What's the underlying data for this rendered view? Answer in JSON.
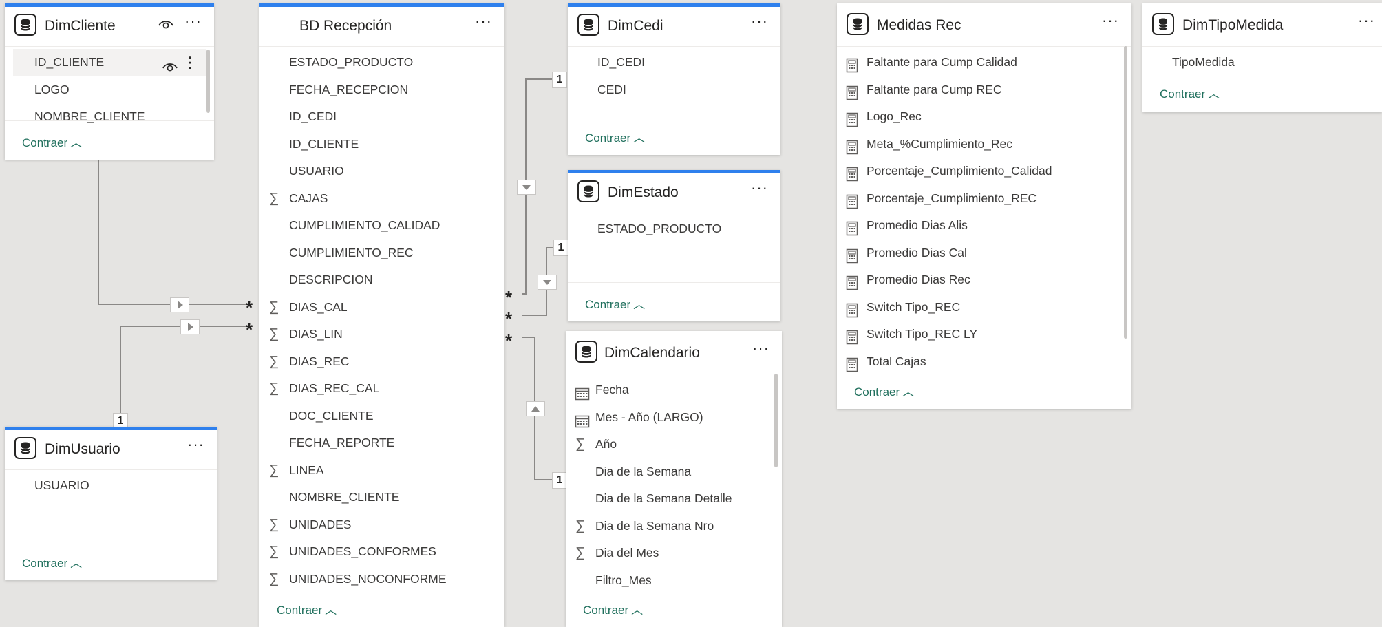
{
  "colors": {
    "canvas": "#e5e4e2",
    "selected_border": "#2f80ed",
    "collapse_link": "#1f6f5c",
    "wire": "#8a8886"
  },
  "collapse_label": "Contraer",
  "tables": {
    "dimcliente": {
      "title": "DimCliente",
      "fields": [
        "ID_CLIENTE",
        "LOGO",
        "NOMBRE_CLIENTE"
      ]
    },
    "bdrecepcion": {
      "title": "BD Recepción",
      "fields": [
        {
          "name": "ESTADO_PRODUCTO",
          "type": "text"
        },
        {
          "name": "FECHA_RECEPCION",
          "type": "text"
        },
        {
          "name": "ID_CEDI",
          "type": "text"
        },
        {
          "name": "ID_CLIENTE",
          "type": "text"
        },
        {
          "name": "USUARIO",
          "type": "text"
        },
        {
          "name": "CAJAS",
          "type": "sum"
        },
        {
          "name": "CUMPLIMIENTO_CALIDAD",
          "type": "text"
        },
        {
          "name": "CUMPLIMIENTO_REC",
          "type": "text"
        },
        {
          "name": "DESCRIPCION",
          "type": "text"
        },
        {
          "name": "DIAS_CAL",
          "type": "sum"
        },
        {
          "name": "DIAS_LIN",
          "type": "sum"
        },
        {
          "name": "DIAS_REC",
          "type": "sum"
        },
        {
          "name": "DIAS_REC_CAL",
          "type": "sum"
        },
        {
          "name": "DOC_CLIENTE",
          "type": "text"
        },
        {
          "name": "FECHA_REPORTE",
          "type": "text"
        },
        {
          "name": "LINEA",
          "type": "sum"
        },
        {
          "name": "NOMBRE_CLIENTE",
          "type": "text"
        },
        {
          "name": "UNIDADES",
          "type": "sum"
        },
        {
          "name": "UNIDADES_CONFORMES",
          "type": "sum"
        },
        {
          "name": "UNIDADES_NOCONFORME",
          "type": "sum"
        }
      ]
    },
    "dimcedi": {
      "title": "DimCedi",
      "fields": [
        "ID_CEDI",
        "CEDI"
      ]
    },
    "dimestado": {
      "title": "DimEstado",
      "fields": [
        "ESTADO_PRODUCTO"
      ]
    },
    "dimcalendario": {
      "title": "DimCalendario",
      "fields": [
        {
          "name": "Fecha",
          "type": "calendar"
        },
        {
          "name": "Mes - Año (LARGO)",
          "type": "calendar"
        },
        {
          "name": "Año",
          "type": "sum"
        },
        {
          "name": "Dia de la Semana",
          "type": "text"
        },
        {
          "name": "Dia de la Semana Detalle",
          "type": "text"
        },
        {
          "name": "Dia de la Semana Nro",
          "type": "sum"
        },
        {
          "name": "Dia del Mes",
          "type": "sum"
        },
        {
          "name": "Filtro_Mes",
          "type": "text"
        }
      ]
    },
    "medidasrec": {
      "title": "Medidas Rec",
      "fields": [
        "Faltante para Cump Calidad",
        "Faltante para Cump REC",
        "Logo_Rec",
        "Meta_%Cumplimiento_Rec",
        "Porcentaje_Cumplimiento_Calidad",
        "Porcentaje_Cumplimiento_REC",
        "Promedio Dias Alis",
        "Promedio Dias Cal",
        "Promedio Dias Rec",
        "Switch Tipo_REC",
        "Switch Tipo_REC LY",
        "Total Cajas"
      ]
    },
    "dimtipomedida": {
      "title": "DimTipoMedida",
      "fields": [
        "TipoMedida"
      ]
    },
    "dimusuario": {
      "title": "DimUsuario",
      "fields": [
        "USUARIO"
      ]
    }
  },
  "relationships": {
    "one_label": "1",
    "many_label": "*"
  }
}
